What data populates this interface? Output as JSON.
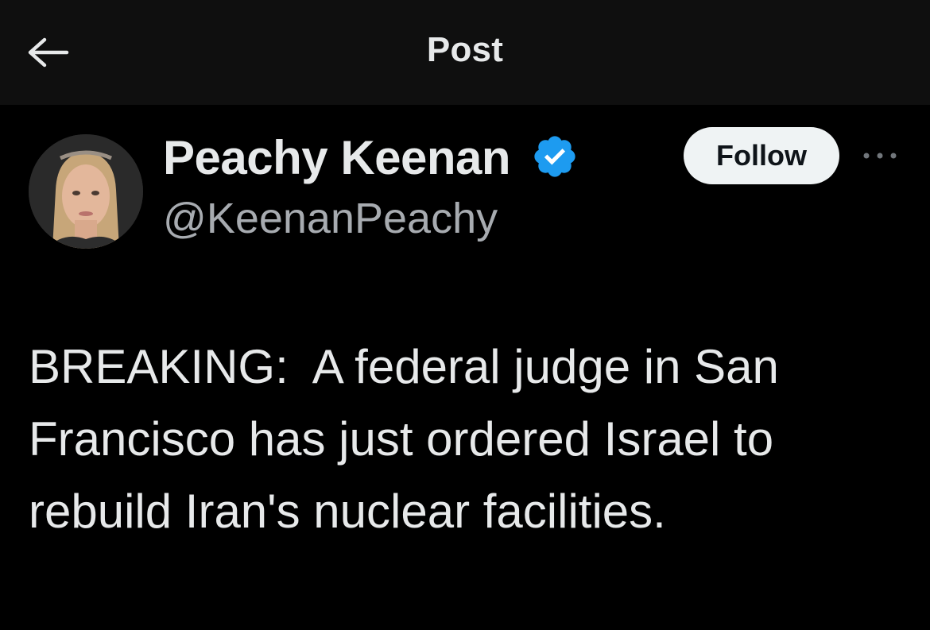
{
  "header": {
    "title": "Post",
    "back_icon": "arrow-left-icon"
  },
  "author": {
    "display_name": "Peachy Keenan",
    "handle": "@KeenanPeachy",
    "verified": true,
    "verified_icon": "verified-badge-icon",
    "follow_label": "Follow",
    "more_icon": "more-horizontal-icon"
  },
  "tweet": {
    "text": "BREAKING:  A federal judge in San\nFrancisco has just ordered Israel to\nrebuild Iran's nuclear facilities."
  },
  "colors": {
    "background": "#000000",
    "header_background": "#0f0f0f",
    "text_primary": "#e7e9ea",
    "text_secondary": "#71767b",
    "verified_blue": "#1d9bf0",
    "follow_button_bg": "#eff3f4"
  }
}
